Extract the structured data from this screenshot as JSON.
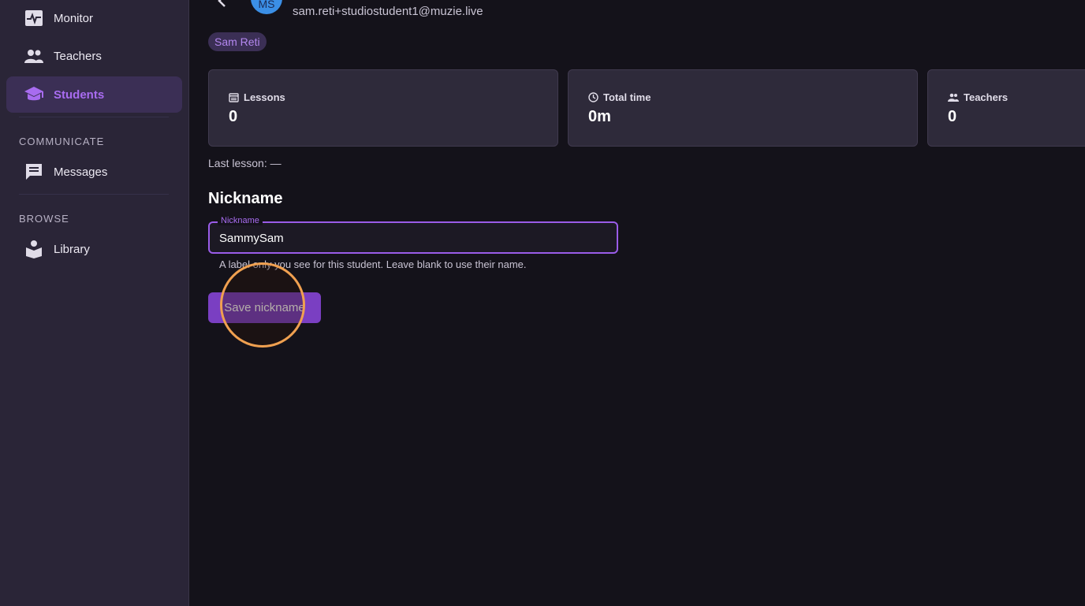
{
  "sidebar": {
    "items": [
      {
        "label": "Monitor",
        "icon": "monitor-heart-icon"
      },
      {
        "label": "Teachers",
        "icon": "people-icon"
      },
      {
        "label": "Students",
        "icon": "graduation-cap-icon",
        "active": true
      },
      {
        "label": "Messages",
        "icon": "chat-icon"
      },
      {
        "label": "Library",
        "icon": "reader-icon"
      }
    ],
    "sections": {
      "communicate": "COMMUNICATE",
      "browse": "BROWSE"
    }
  },
  "header": {
    "avatar_initials": "MS",
    "email": "sam.reti+studiostudent1@muzie.live",
    "tag": "Sam Reti"
  },
  "stats": [
    {
      "label": "Lessons",
      "value": "0",
      "icon": "calendar-icon"
    },
    {
      "label": "Total time",
      "value": "0m",
      "icon": "clock-icon"
    },
    {
      "label": "Teachers",
      "value": "0",
      "icon": "people-icon"
    }
  ],
  "last_lesson": "Last lesson: —",
  "nickname": {
    "title": "Nickname",
    "field_label": "Nickname",
    "value": "SammySam",
    "helper": "A label only you see for this student. Leave blank to use their name.",
    "save_label": "Save nickname"
  },
  "colors": {
    "accent": "#9a5ce8",
    "button": "#7a3fc2",
    "highlight_ring": "#f0a050"
  }
}
